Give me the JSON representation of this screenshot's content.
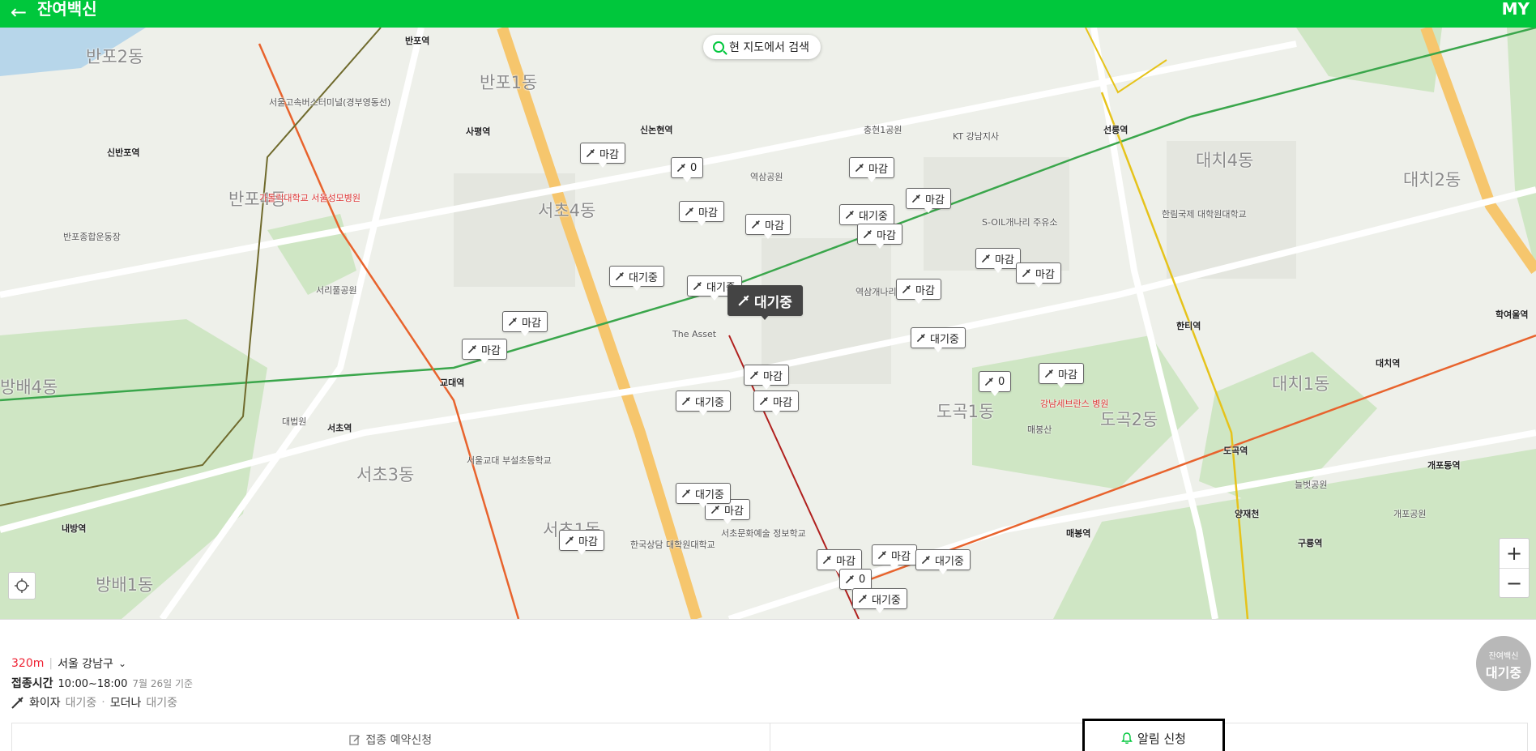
{
  "header": {
    "back_glyph": "←",
    "title": "잔여백신",
    "my_label": "MY"
  },
  "map": {
    "search_label": "현 지도에서 검색",
    "zoom_in": "+",
    "zoom_out": "−",
    "district_labels": [
      "반포2동",
      "반포1동",
      "반포4동",
      "서초4동",
      "대치4동",
      "대치2동",
      "방배4동",
      "도곡1동",
      "도곡2동",
      "서초1동",
      "서초3동",
      "방배1동",
      "대치1동"
    ],
    "station_labels": [
      "반포역",
      "사평역",
      "신논현역",
      "신반포역",
      "선릉역",
      "교대역",
      "서초역",
      "내방역",
      "한티역",
      "대치역",
      "도곡역",
      "매봉역",
      "구룡역",
      "개포동역",
      "학여울역",
      "양재천"
    ],
    "place_labels": [
      "서울고속버스터미널(경부영동선)",
      "가톨릭대학교 서울성모병원",
      "반포종합운동장",
      "서리풀공원",
      "대법원",
      "서울교대 부설초등학교",
      "강남세브란스 병원",
      "매봉산",
      "역삼공원",
      "충현1공원",
      "KT 강남지사",
      "한림국제 대학원대학교",
      "역삼개나리 공원",
      "The Asset",
      "한국상담 대학원대학교",
      "서초문화예술 정보학교",
      "S-OIL개나리 주유소",
      "개포공원",
      "늘벗공원"
    ],
    "markers": [
      {
        "label": "마감",
        "style": "normal"
      },
      {
        "label": "0",
        "style": "normal"
      },
      {
        "label": "마감",
        "style": "normal"
      },
      {
        "label": "마감",
        "style": "normal"
      },
      {
        "label": "마감",
        "style": "normal"
      },
      {
        "label": "대기중",
        "style": "normal"
      },
      {
        "label": "마감",
        "style": "normal"
      },
      {
        "label": "마감",
        "style": "normal"
      },
      {
        "label": "마감",
        "style": "normal"
      },
      {
        "label": "마감",
        "style": "normal"
      },
      {
        "label": "대기중",
        "style": "normal"
      },
      {
        "label": "대기중",
        "style": "normal"
      },
      {
        "label": "대기중",
        "style": "active"
      },
      {
        "label": "마감",
        "style": "normal"
      },
      {
        "label": "마감",
        "style": "normal"
      },
      {
        "label": "마감",
        "style": "normal"
      },
      {
        "label": "대기중",
        "style": "normal"
      },
      {
        "label": "마감",
        "style": "normal"
      },
      {
        "label": "마감",
        "style": "normal"
      },
      {
        "label": "대기중",
        "style": "normal"
      },
      {
        "label": "0",
        "style": "normal"
      },
      {
        "label": "마감",
        "style": "normal"
      },
      {
        "label": "마감",
        "style": "normal"
      },
      {
        "label": "대기중",
        "style": "normal"
      },
      {
        "label": "마감",
        "style": "normal"
      },
      {
        "label": "마감",
        "style": "normal"
      },
      {
        "label": "마감",
        "style": "normal"
      },
      {
        "label": "대기중",
        "style": "normal"
      },
      {
        "label": "0",
        "style": "normal"
      },
      {
        "label": "대기중",
        "style": "normal"
      }
    ]
  },
  "info": {
    "distance": "320m",
    "region": "서울 강남구",
    "chevron": "⌄",
    "hours_label": "접종시간",
    "hours": "10:00~18:00",
    "basis": "7월 26일 기준",
    "vaccines": [
      {
        "name": "화이자",
        "status": "대기중"
      },
      {
        "name": "모더나",
        "status": "대기중"
      }
    ],
    "badge_small": "잔여백신",
    "badge_main": "대기중",
    "reserve_label": "접종 예약신청",
    "alert_label": "알림 신청"
  },
  "colors": {
    "brand": "#00c73c",
    "distance": "#ee2233",
    "marker_active": "#444444"
  }
}
